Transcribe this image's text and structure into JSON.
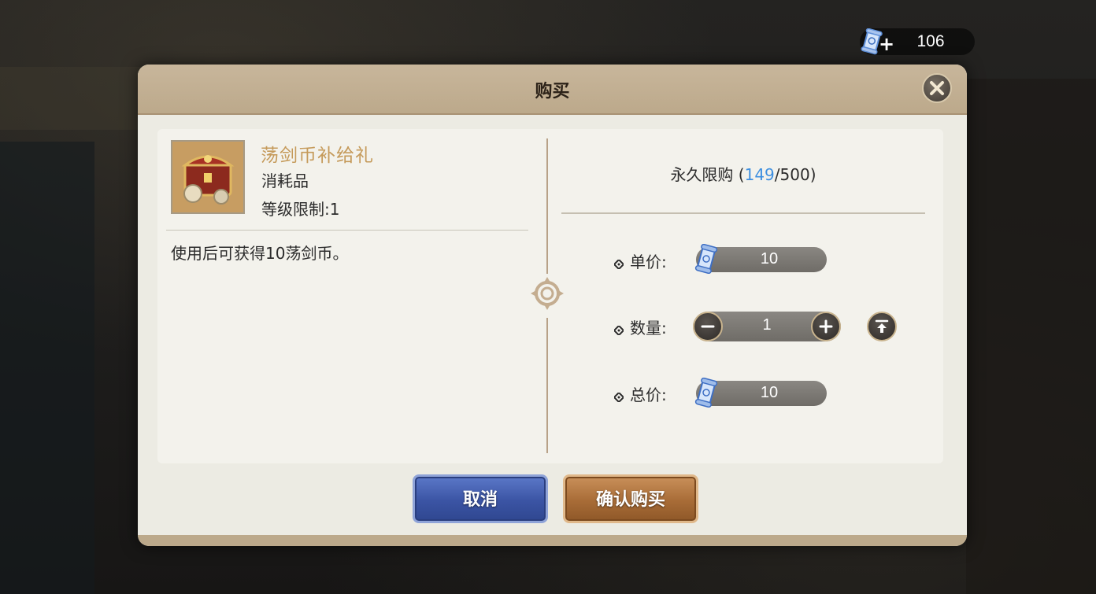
{
  "currency": {
    "value": "106",
    "icon": "ticket-scroll-icon",
    "add_icon": "plus-icon"
  },
  "dialog": {
    "title": "购买",
    "close_icon": "close-icon",
    "item": {
      "name": "荡剑币补给礼",
      "type": "消耗品",
      "level_limit": "等级限制:1",
      "description": "使用后可获得10荡剑币。",
      "icon": "treasure-chest-icon"
    },
    "limit": {
      "label": "永久限购",
      "current": "149",
      "max": "500"
    },
    "unit_price": {
      "label": "单价:",
      "value": "10"
    },
    "quantity": {
      "label": "数量:",
      "value": "1"
    },
    "total_price": {
      "label": "总价:",
      "value": "10"
    },
    "buttons": {
      "cancel": "取消",
      "confirm": "确认购买"
    }
  },
  "colors": {
    "accent_blue": "#3d8fe0",
    "item_name": "#c59a5a",
    "cancel_button": "#3b54a4",
    "confirm_button": "#a86c37"
  }
}
